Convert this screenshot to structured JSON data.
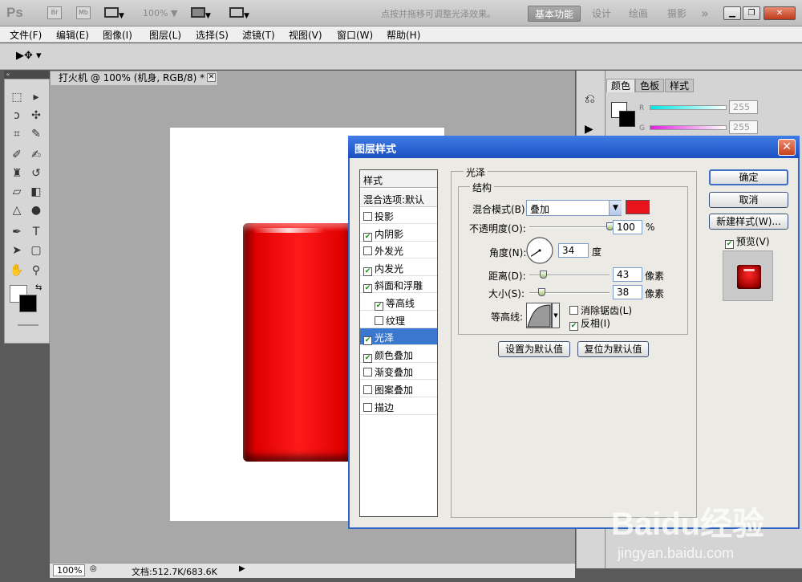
{
  "app": {
    "logo": "Ps",
    "launch_br": "Br",
    "launch_mb": "Mb",
    "zoom_top": "100%",
    "workspaces": [
      "基本功能",
      "设计",
      "绘画",
      "摄影"
    ],
    "workspace_more": "»"
  },
  "menu": [
    "文件(F)",
    "编辑(E)",
    "图像(I)",
    "图层(L)",
    "选择(S)",
    "滤镜(T)",
    "视图(V)",
    "窗口(W)",
    "帮助(H)"
  ],
  "options_bar": {
    "hint": "点按并拖移可调整光泽效果。"
  },
  "document": {
    "tab_title": "打火机 @ 100% (机身, RGB/8) *",
    "zoom": "100%",
    "doc_info": "文档:512.7K/683.6K",
    "shape_color": "#e00000"
  },
  "color_panel": {
    "tabs": [
      "颜色",
      "色板",
      "样式"
    ],
    "r_label": "R",
    "g_label": "G",
    "r_value": "255",
    "g_value": "255"
  },
  "dialog": {
    "title": "图层样式",
    "close": "✕",
    "styles_header": "样式",
    "blend_options": "混合选项:默认",
    "effects": [
      {
        "label": "投影",
        "checked": false,
        "indent": false,
        "selected": false
      },
      {
        "label": "内阴影",
        "checked": true,
        "indent": false,
        "selected": false
      },
      {
        "label": "外发光",
        "checked": false,
        "indent": false,
        "selected": false
      },
      {
        "label": "内发光",
        "checked": true,
        "indent": false,
        "selected": false
      },
      {
        "label": "斜面和浮雕",
        "checked": true,
        "indent": false,
        "selected": false
      },
      {
        "label": "等高线",
        "checked": true,
        "indent": true,
        "selected": false
      },
      {
        "label": "纹理",
        "checked": false,
        "indent": true,
        "selected": false
      },
      {
        "label": "光泽",
        "checked": true,
        "indent": false,
        "selected": true
      },
      {
        "label": "颜色叠加",
        "checked": true,
        "indent": false,
        "selected": false
      },
      {
        "label": "渐变叠加",
        "checked": false,
        "indent": false,
        "selected": false
      },
      {
        "label": "图案叠加",
        "checked": false,
        "indent": false,
        "selected": false
      },
      {
        "label": "描边",
        "checked": false,
        "indent": false,
        "selected": false
      }
    ],
    "section_title": "光泽",
    "structure_title": "结构",
    "blend_mode_label": "混合模式(B):",
    "blend_mode_value": "叠加",
    "blend_color": "#e8141c",
    "opacity_label": "不透明度(O):",
    "opacity_value": "100",
    "opacity_unit": "%",
    "opacity_level": 1.0,
    "angle_label": "角度(N):",
    "angle_value": "34",
    "angle_unit": "度",
    "distance_label": "距离(D):",
    "distance_value": "43",
    "distance_unit": "像素",
    "distance_level": 0.17,
    "size_label": "大小(S):",
    "size_value": "38",
    "size_unit": "像素",
    "size_level": 0.15,
    "contour_label": "等高线:",
    "antialias_label": "消除锯齿(L)",
    "antialias_checked": false,
    "invert_label": "反相(I)",
    "invert_checked": true,
    "make_default": "设置为默认值",
    "reset_default": "复位为默认值",
    "ok": "确定",
    "cancel": "取消",
    "new_style": "新建样式(W)...",
    "preview_label": "预览(V)",
    "preview_checked": true
  },
  "watermark": {
    "logo": "Baidu经验",
    "url": "jingyan.baidu.com"
  }
}
